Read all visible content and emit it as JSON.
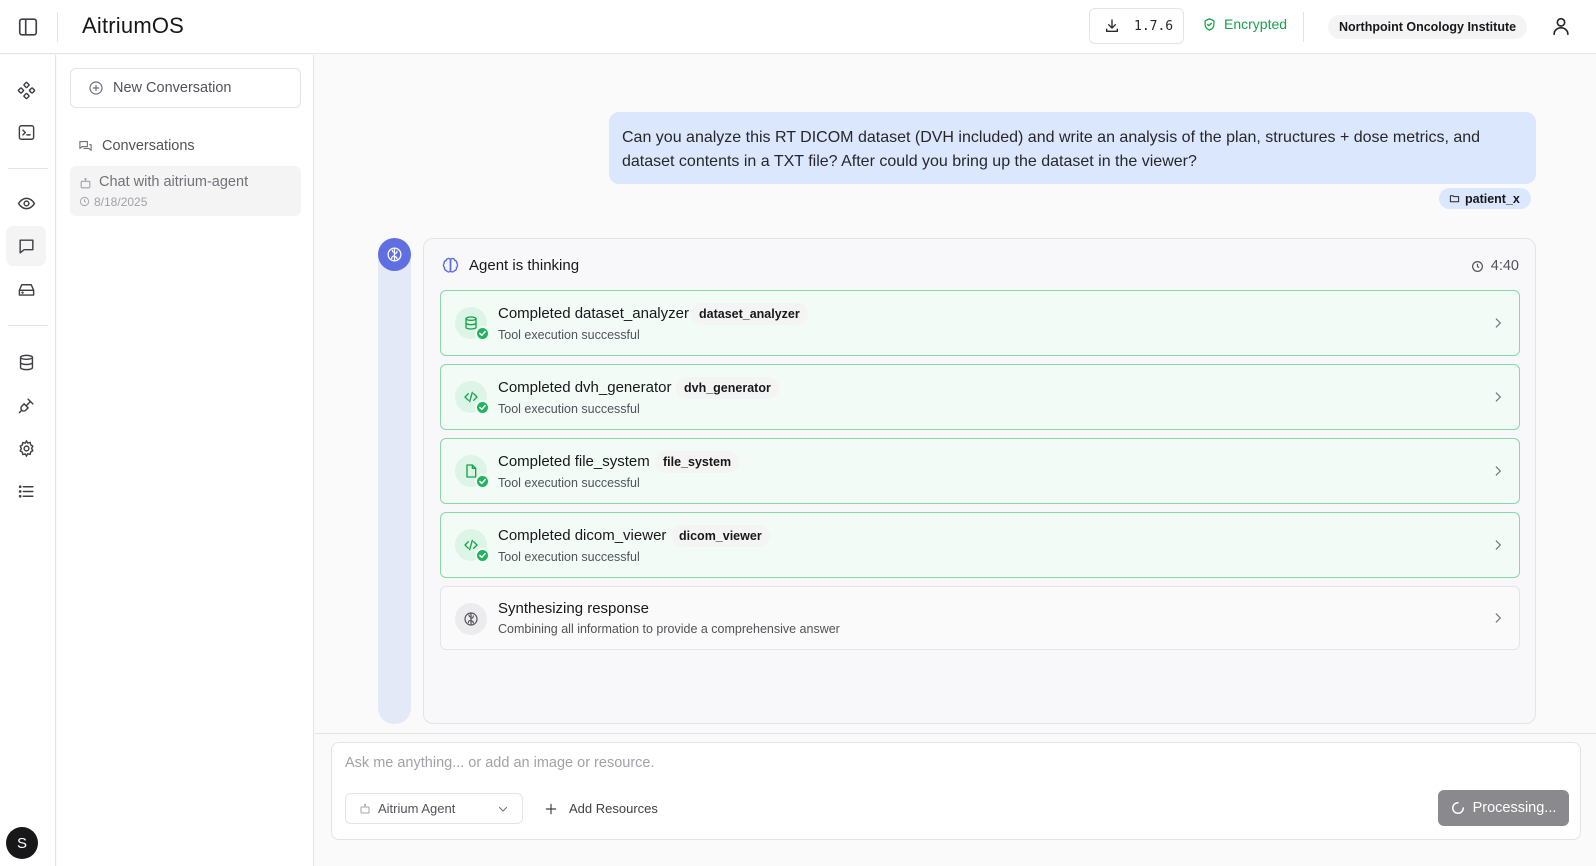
{
  "app": {
    "logo": "AitriumOS"
  },
  "header": {
    "version": "1.7.6",
    "encrypted_label": "Encrypted",
    "organization": "Northpoint Oncology Institute"
  },
  "user": {
    "avatar_initial": "S"
  },
  "sidebar": {
    "new_conversation_label": "New Conversation",
    "conversations_heading": "Conversations",
    "conversations": [
      {
        "title": "Chat with aitrium-agent",
        "date": "8/18/2025"
      }
    ]
  },
  "chat": {
    "user_message": "Can you analyze this RT DICOM dataset (DVH included) and write an analysis of the plan, structures + dose metrics, and dataset contents in a TXT file? After could you bring up the dataset in the viewer?",
    "attachment": "patient_x",
    "thinking": {
      "label": "Agent is thinking",
      "elapsed": "4:40",
      "steps": [
        {
          "title": "Completed dataset_analyzer",
          "tag": "dataset_analyzer",
          "subtitle": "Tool execution successful",
          "status": "completed",
          "icon": "database-icon"
        },
        {
          "title": "Completed dvh_generator",
          "tag": "dvh_generator",
          "subtitle": "Tool execution successful",
          "status": "completed",
          "icon": "code-icon"
        },
        {
          "title": "Completed file_system",
          "tag": "file_system",
          "subtitle": "Tool execution successful",
          "status": "completed",
          "icon": "file-icon"
        },
        {
          "title": "Completed dicom_viewer",
          "tag": "dicom_viewer",
          "subtitle": "Tool execution successful",
          "status": "completed",
          "icon": "code-icon"
        },
        {
          "title": "Synthesizing response",
          "subtitle": "Combining all information to provide a comprehensive answer",
          "status": "in-progress",
          "icon": "brain-icon"
        }
      ]
    }
  },
  "composer": {
    "placeholder": "Ask me anything... or add an image or resource.",
    "agent_select": "Aitrium Agent",
    "add_resources_label": "Add Resources",
    "processing_label": "Processing..."
  },
  "colors": {
    "accent": "#5f6ee0",
    "success": "#16a34a",
    "user_bubble": "#dbe7fd"
  }
}
